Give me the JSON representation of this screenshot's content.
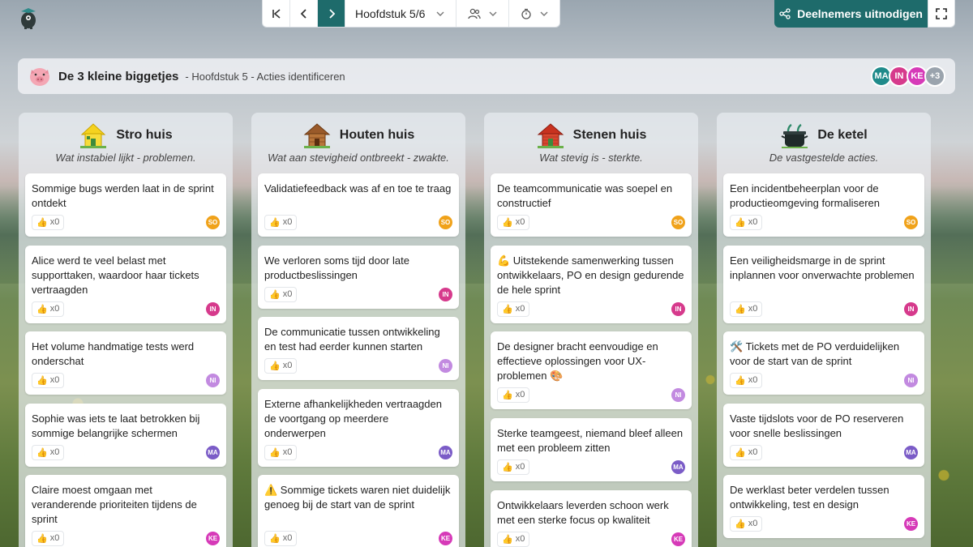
{
  "nav": {
    "chapter": "Hoofdstuk 5/6"
  },
  "invite": {
    "label": "Deelnemers uitnodigen"
  },
  "header": {
    "title": "De 3 kleine biggetjes",
    "subtitle": "- Hoofdstuk 5 - Acties identificeren"
  },
  "participants": [
    {
      "initials": "MA",
      "color": "#1f8a8a"
    },
    {
      "initials": "IN",
      "color": "#d63a8c"
    },
    {
      "initials": "KE",
      "color": "#d63ab8"
    }
  ],
  "participants_more": "+3",
  "colors": {
    "accent": "#1e6b6b"
  },
  "columns": [
    {
      "title": "Stro huis",
      "description": "Wat instabiel lijkt - problemen.",
      "icon": "straw-house-icon",
      "cards": [
        {
          "text": "Sommige bugs werden laat in de sprint ontdekt",
          "likes": "x0",
          "author": "SO"
        },
        {
          "text": "Alice werd te veel belast met supporttaken, waardoor haar tickets vertraagden",
          "likes": "x0",
          "author": "IN"
        },
        {
          "text": "Het volume handmatige tests werd onderschat",
          "likes": "x0",
          "author": "NI"
        },
        {
          "text": "Sophie was iets te laat betrokken bij sommige belangrijke schermen",
          "likes": "x0",
          "author": "MA"
        },
        {
          "text": "Claire moest omgaan met veranderende prioriteiten tijdens de sprint",
          "likes": "x0",
          "author": "KE"
        }
      ]
    },
    {
      "title": "Houten huis",
      "description": "Wat aan stevigheid ontbreekt - zwakte.",
      "icon": "wooden-house-icon",
      "cards": [
        {
          "text": "Validatiefeedback was af en toe te traag",
          "likes": "x0",
          "author": "SO"
        },
        {
          "text": "We verloren soms tijd door late productbeslissingen",
          "likes": "x0",
          "author": "IN"
        },
        {
          "text": "De communicatie tussen ontwikkeling en test had eerder kunnen starten",
          "likes": "x0",
          "author": "NI"
        },
        {
          "text": "Externe afhankelijkheden vertraagden de voortgang op meerdere onderwerpen",
          "likes": "x0",
          "author": "MA"
        },
        {
          "text": "⚠️ Sommige tickets waren niet duidelijk genoeg bij de start van de sprint",
          "likes": "x0",
          "author": "KE"
        }
      ]
    },
    {
      "title": "Stenen huis",
      "description": "Wat stevig is - sterkte.",
      "icon": "brick-house-icon",
      "cards": [
        {
          "text": "De teamcommunicatie was soepel en constructief",
          "likes": "x0",
          "author": "SO"
        },
        {
          "text": "💪 Uitstekende samenwerking tussen ontwikkelaars, PO en design gedurende de hele sprint",
          "likes": "x0",
          "author": "IN"
        },
        {
          "text": "De designer bracht eenvoudige en effectieve oplossingen voor UX-problemen 🎨",
          "likes": "x0",
          "author": "NI"
        },
        {
          "text": "Sterke teamgeest, niemand bleef alleen met een probleem zitten",
          "likes": "x0",
          "author": "MA"
        },
        {
          "text": "Ontwikkelaars leverden schoon werk met een sterke focus op kwaliteit",
          "likes": "x0",
          "author": "KE"
        }
      ]
    },
    {
      "title": "De ketel",
      "description": "De vastgestelde acties.",
      "icon": "kettle-icon",
      "cards": [
        {
          "text": "Een incidentbeheerplan voor de productieomgeving formaliseren",
          "likes": "x0",
          "author": "SO"
        },
        {
          "text": "Een veiligheidsmarge in de sprint inplannen voor onverwachte problemen",
          "likes": "x0",
          "author": "IN"
        },
        {
          "text": "🛠️ Tickets met de PO verduidelijken voor de start van de sprint",
          "likes": "x0",
          "author": "NI"
        },
        {
          "text": "Vaste tijdslots voor de PO reserveren voor snelle beslissingen",
          "likes": "x0",
          "author": "MA"
        },
        {
          "text": "De werklast beter verdelen tussen ontwikkeling, test en design",
          "likes": "x0",
          "author": "KE"
        }
      ]
    }
  ]
}
